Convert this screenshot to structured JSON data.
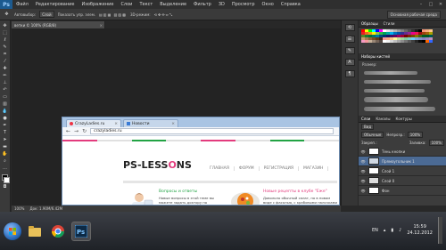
{
  "app": {
    "logo": "Ps"
  },
  "menu": [
    "Файл",
    "Редактирование",
    "Изображение",
    "Слои",
    "Текст",
    "Выделение",
    "Фильтр",
    "3D",
    "Просмотр",
    "Окно",
    "Справка"
  ],
  "window_controls": [
    "–",
    "□",
    "✕"
  ],
  "options_bar": {
    "autoselect_label": "Автовыбор:",
    "autoselect_value": "Слой",
    "transform_label": "Показать упр. элем.",
    "mode_3d": "3D-режим:",
    "workspace": "Основная рабочая среда"
  },
  "document_tab": {
    "title": "вeтки © 100% (RGB/8)",
    "close": "×"
  },
  "status_bar": {
    "zoom": "100%",
    "doc": "Док: 1.90M/6.42M"
  },
  "panels": {
    "swatches_tabs": [
      "Образцы",
      "Стили"
    ],
    "brushes_tabs": [
      "Наборы кистей"
    ],
    "brush_label": "Размер:",
    "layers_tabs": [
      "Слои",
      "Каналы",
      "Контуры"
    ],
    "kind_label": "Вид",
    "blend_mode": "Обычные",
    "opacity_label": "Непрозр.:",
    "opacity_value": "100%",
    "lock_label": "Закреп.:",
    "fill_label": "Заливка:",
    "fill_value": "100%",
    "layers": [
      {
        "name": "Тень кнопки",
        "selected": false
      },
      {
        "name": "Прямоугольник 1",
        "selected": true
      },
      {
        "name": "Слой 1",
        "selected": false
      },
      {
        "name": "Слой 0",
        "selected": false
      },
      {
        "name": "Фон",
        "selected": false
      }
    ]
  },
  "browser": {
    "tabs": [
      {
        "title": "CrazyLadies.ru",
        "close": "×"
      },
      {
        "title": "Новости",
        "close": "×"
      }
    ],
    "url": "crazyladies.ru",
    "site_logo_a": "PS-LESS",
    "site_logo_o": "O",
    "site_logo_b": "NS",
    "site_nav": [
      "ГЛАВНАЯ",
      "ФОРУМ",
      "РЕГИСТРАЦИЯ",
      "МАГАЗИН"
    ],
    "card_left": {
      "title": "Вопросы и ответы",
      "text": "Новые вопросы в этой теме вы можете задать доктору по медицине"
    },
    "card_right": {
      "title": "Новые рецепты в клубе \"Еже\"",
      "text": "Довольно обычный салат, но в новом виде с фасолью, с крабовыми палочками"
    }
  },
  "taskbar": {
    "lang": "EN",
    "time": "15:59",
    "date": "24.12.2012"
  },
  "colors": {
    "accent_pink": "#e33b7d",
    "accent_green": "#22a344",
    "layer_selected": "#4b6a94"
  }
}
